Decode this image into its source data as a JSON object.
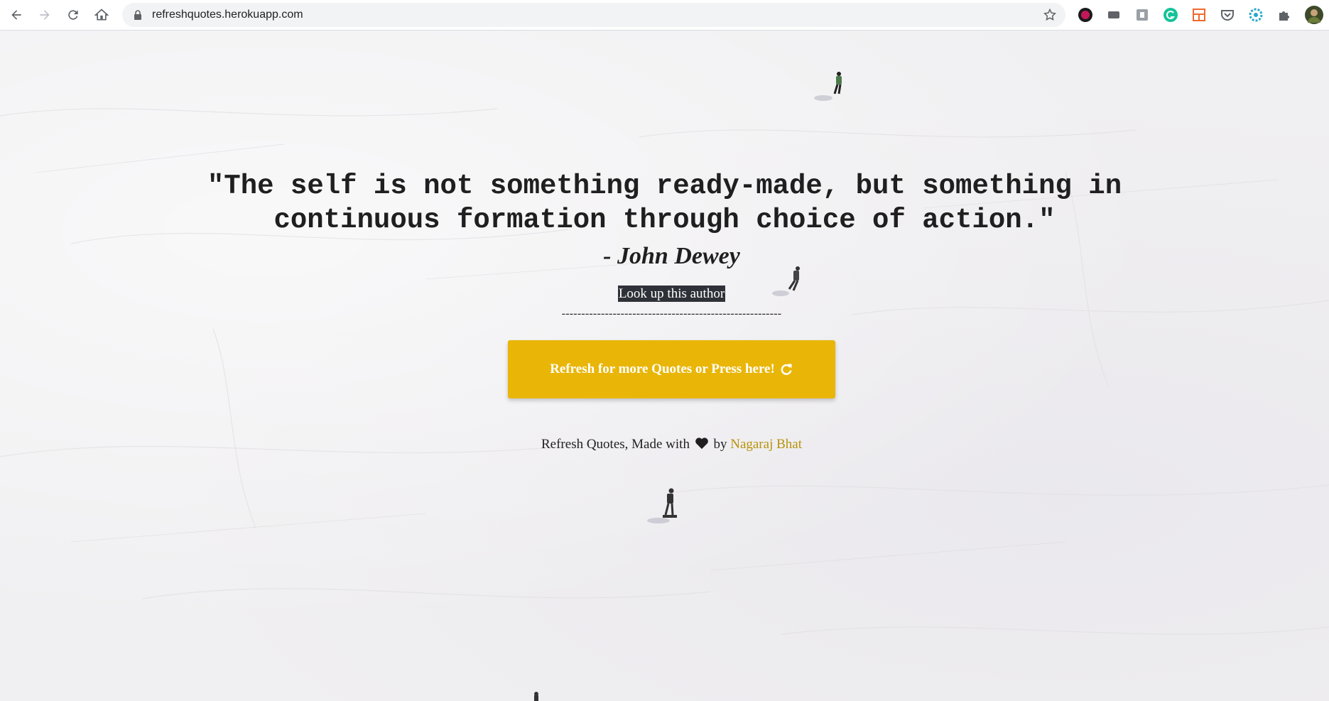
{
  "browser": {
    "url": "refreshquotes.herokuapp.com",
    "nav_icons": [
      "back-icon",
      "forward-icon",
      "reload-icon",
      "home-icon"
    ],
    "extensions": [
      "extension-red-circle-icon",
      "extension-dark-icon",
      "extension-gray-icon",
      "grammarly-icon",
      "extension-orange-layout-icon",
      "pocket-icon",
      "extension-gear-icon",
      "extensions-puzzle-icon",
      "profile-avatar"
    ]
  },
  "quote": {
    "text": "\"The self is not something ready-made, but something in continuous formation through choice of action.\"",
    "author": "- John Dewey",
    "lookup_label": "Look up this author",
    "divider": "--------------------------------------------------------"
  },
  "refresh_button": {
    "label": "Refresh for more Quotes or Press here!",
    "icon": "refresh-icon",
    "color": "#e9b608"
  },
  "footer": {
    "prefix": "Refresh Quotes, Made with",
    "by": "by",
    "author_link": "Nagaraj Bhat",
    "link_color": "#b8920a"
  }
}
